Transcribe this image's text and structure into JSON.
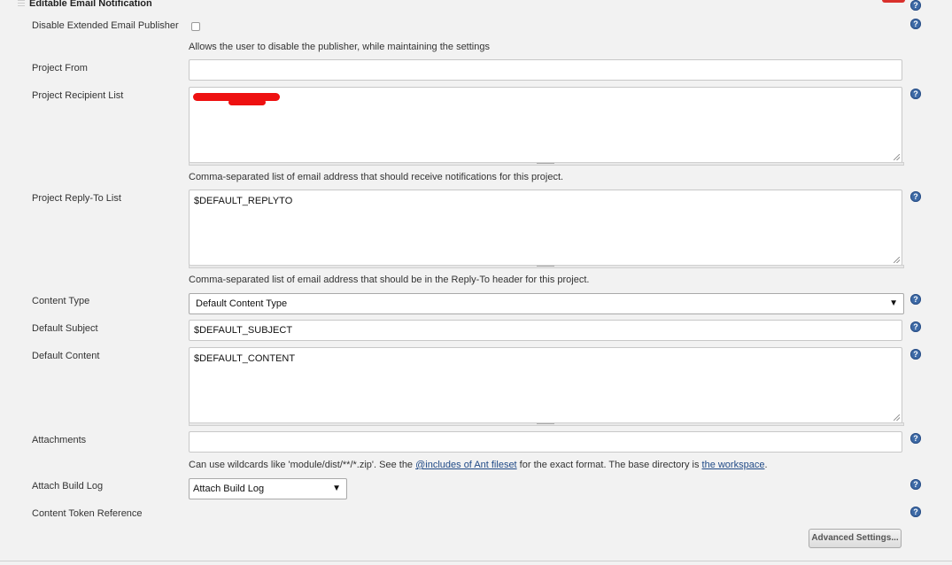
{
  "section": {
    "title": "Editable Email Notification"
  },
  "help_glyph": "?",
  "disable_publisher": {
    "label": "Disable Extended Email Publisher",
    "checked": false,
    "description": "Allows the user to disable the publisher, while maintaining the settings"
  },
  "project_from": {
    "label": "Project From",
    "value": ""
  },
  "recipient_list": {
    "label": "Project Recipient List",
    "value_redacted": true,
    "description": "Comma-separated list of email address that should receive notifications for this project."
  },
  "reply_to": {
    "label": "Project Reply-To List",
    "value": "$DEFAULT_REPLYTO",
    "description": "Comma-separated list of email address that should be in the Reply-To header for this project."
  },
  "content_type": {
    "label": "Content Type",
    "selected": "Default Content Type",
    "arrow": "▼"
  },
  "default_subject": {
    "label": "Default Subject",
    "value": "$DEFAULT_SUBJECT"
  },
  "default_content": {
    "label": "Default Content",
    "value": "$DEFAULT_CONTENT"
  },
  "attachments": {
    "label": "Attachments",
    "value": "",
    "description_prefix": "Can use wildcards like 'module/dist/**/*.zip'. See the ",
    "link1": "@includes of Ant fileset",
    "description_middle": " for the exact format. The base directory is ",
    "link2": "the workspace",
    "description_suffix": "."
  },
  "attach_build_log": {
    "label": "Attach Build Log",
    "selected": "Attach Build Log",
    "arrow": "▼"
  },
  "content_token_reference": {
    "label": "Content Token Reference"
  },
  "advanced_button": {
    "label": "Advanced Settings..."
  },
  "colors": {
    "accent_red": "#d9302c",
    "link": "#204a87",
    "help": "#3d6aa6"
  }
}
